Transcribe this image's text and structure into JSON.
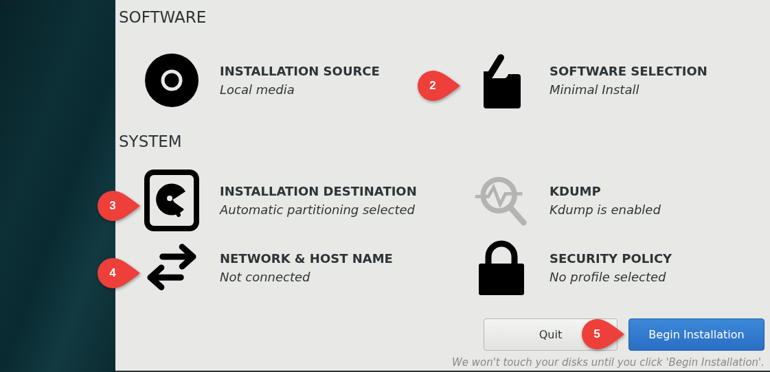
{
  "sections": [
    {
      "heading": "SOFTWARE",
      "spokes": [
        {
          "kind": "disc",
          "title": "INSTALLATION SOURCE",
          "status": "Local media",
          "dimmed": false
        },
        {
          "kind": "package",
          "title": "SOFTWARE SELECTION",
          "status": "Minimal Install",
          "dimmed": false,
          "callout": "2"
        }
      ]
    },
    {
      "heading": "SYSTEM",
      "spokes": [
        {
          "kind": "disk",
          "title": "INSTALLATION DESTINATION",
          "status": "Automatic partitioning selected",
          "dimmed": false,
          "callout": "3"
        },
        {
          "kind": "kdump",
          "title": "KDUMP",
          "status": "Kdump is enabled",
          "dimmed": true
        },
        {
          "kind": "network",
          "title": "NETWORK & HOST NAME",
          "status": "Not connected",
          "dimmed": false,
          "callout": "4"
        },
        {
          "kind": "lock",
          "title": "SECURITY POLICY",
          "status": "No profile selected",
          "dimmed": false
        }
      ]
    }
  ],
  "buttons": [
    {
      "label": "Quit",
      "kind": "secondary"
    },
    {
      "label": "Begin Installation",
      "kind": "primary",
      "callout": "5"
    }
  ],
  "footer": "We won't touch your disks until you click 'Begin Installation'."
}
